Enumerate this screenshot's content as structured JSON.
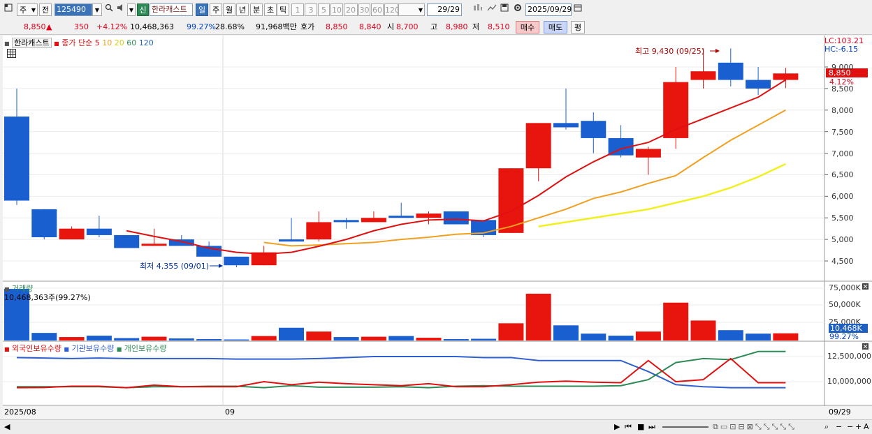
{
  "toolbar": {
    "market_select": "주",
    "market_prev": "전",
    "code": "125490",
    "new_badge": "신",
    "stock_name": "한라캐스트",
    "period_tabs": [
      "일",
      "주",
      "월",
      "년",
      "분",
      "초",
      "틱"
    ],
    "period_selected": "일",
    "intervals": [
      "1",
      "3",
      "5",
      "10",
      "20",
      "30",
      "60",
      "120"
    ],
    "count": "29/29",
    "date": "2025/09/29"
  },
  "infobar": {
    "price": "8,850",
    "change": "350",
    "change_pct": "+4.12%",
    "volume": "10,468,363",
    "vol_ratio": "99.27%",
    "turnover_ratio": "28.68%",
    "amount": "91,968백만",
    "quote_label": "호가",
    "ask": "8,850",
    "bid": "8,840",
    "open_label": "시",
    "open": "8,700",
    "high_label": "고",
    "high": "8,980",
    "low_label": "저",
    "low": "8,510",
    "buy_button": "매수",
    "sell_button": "매도",
    "eval_button": "평"
  },
  "price_panel": {
    "name_label": "한라캐스트",
    "ma_label": "종가 단순",
    "ma_periods": [
      "5",
      "10",
      "20",
      "60",
      "120"
    ],
    "ma_colors": [
      "#e01010",
      "#f0a020",
      "#f0f020",
      "#2e8b57",
      "#2060c0"
    ],
    "lc_label": "LC:103.21",
    "hc_label": "HC:-6.15",
    "high_annotation": "최고 9,430 (09/25)",
    "low_annotation": "최저 4,355 (09/01)",
    "current_price_tag": "8,850",
    "current_pct_tag": "4.12%",
    "yticks": [
      "9,000",
      "8,500",
      "8,000",
      "7,500",
      "7,000",
      "6,500",
      "6,000",
      "5,500",
      "5,000",
      "4,500"
    ]
  },
  "volume_panel": {
    "title": "거래량",
    "info": "10,468,363주(99.27%)",
    "yticks": [
      "75,000K",
      "50,000K",
      "25,000K"
    ],
    "current_tag": "10,468K",
    "current_pct": "99.27%"
  },
  "holdings_panel": {
    "legend": [
      "외국인보유수량",
      "기관보유수량",
      "개인보유수량"
    ],
    "legend_colors": [
      "#e01010",
      "#3060d0",
      "#2e8b57"
    ],
    "yticks": [
      "12,500,000",
      "10,000,000"
    ]
  },
  "xaxis": {
    "start_label": "2025/08",
    "mid_label": "09",
    "end_label": "09/29"
  },
  "chart_data": {
    "type": "candlestick",
    "candles": [
      {
        "o": 7850,
        "h": 8500,
        "l": 5800,
        "c": 5900
      },
      {
        "o": 5700,
        "h": 5700,
        "l": 5000,
        "c": 5050
      },
      {
        "o": 5000,
        "h": 5300,
        "l": 5000,
        "c": 5250
      },
      {
        "o": 5250,
        "h": 5550,
        "l": 5050,
        "c": 5100
      },
      {
        "o": 5100,
        "h": 5100,
        "l": 4800,
        "c": 4800
      },
      {
        "o": 4850,
        "h": 5250,
        "l": 4850,
        "c": 4900
      },
      {
        "o": 5000,
        "h": 5100,
        "l": 4850,
        "c": 4850
      },
      {
        "o": 4850,
        "h": 4950,
        "l": 4600,
        "c": 4600
      },
      {
        "o": 4600,
        "h": 4600,
        "l": 4355,
        "c": 4400
      },
      {
        "o": 4400,
        "h": 4850,
        "l": 4400,
        "c": 4700
      },
      {
        "o": 5000,
        "h": 5500,
        "l": 4950,
        "c": 4950
      },
      {
        "o": 5000,
        "h": 5650,
        "l": 4950,
        "c": 5400
      },
      {
        "o": 5450,
        "h": 5500,
        "l": 5250,
        "c": 5400
      },
      {
        "o": 5400,
        "h": 5650,
        "l": 5400,
        "c": 5500
      },
      {
        "o": 5550,
        "h": 5850,
        "l": 5500,
        "c": 5500
      },
      {
        "o": 5500,
        "h": 5650,
        "l": 5350,
        "c": 5600
      },
      {
        "o": 5650,
        "h": 5650,
        "l": 5350,
        "c": 5350
      },
      {
        "o": 5450,
        "h": 5450,
        "l": 5050,
        "c": 5100
      },
      {
        "o": 5150,
        "h": 6650,
        "l": 5150,
        "c": 6650
      },
      {
        "o": 6650,
        "h": 7350,
        "l": 6350,
        "c": 7700
      },
      {
        "o": 7700,
        "h": 8500,
        "l": 7550,
        "c": 7600
      },
      {
        "o": 7750,
        "h": 7950,
        "l": 7000,
        "c": 7350
      },
      {
        "o": 7350,
        "h": 7650,
        "l": 6900,
        "c": 6950
      },
      {
        "o": 6900,
        "h": 7150,
        "l": 6500,
        "c": 7100
      },
      {
        "o": 7350,
        "h": 9000,
        "l": 7100,
        "c": 8650
      },
      {
        "o": 8700,
        "h": 9430,
        "l": 8500,
        "c": 8900
      },
      {
        "o": 9100,
        "h": 9430,
        "l": 8550,
        "c": 8700
      },
      {
        "o": 8700,
        "h": 9000,
        "l": 8350,
        "c": 8500
      },
      {
        "o": 8700,
        "h": 8980,
        "l": 8510,
        "c": 8850
      }
    ],
    "volume_k": [
      75000,
      11000,
      5000,
      7000,
      3500,
      5500,
      3000,
      2000,
      1500,
      6500,
      18500,
      13000,
      5000,
      5500,
      6500,
      4000,
      2000,
      2500,
      25000,
      68000,
      22000,
      10000,
      7000,
      13000,
      55000,
      29000,
      15000,
      10000,
      10468
    ],
    "volume_up": [
      false,
      false,
      true,
      false,
      false,
      true,
      false,
      false,
      false,
      true,
      false,
      true,
      false,
      true,
      false,
      true,
      false,
      false,
      true,
      true,
      false,
      false,
      false,
      true,
      true,
      true,
      false,
      false,
      true
    ],
    "ma5": [
      null,
      null,
      null,
      null,
      5200,
      5070,
      4950,
      4800,
      4700,
      4660,
      4700,
      4840,
      5000,
      5200,
      5350,
      5450,
      5470,
      5430,
      5650,
      6020,
      6450,
      6800,
      7100,
      7250,
      7550,
      7800,
      8050,
      8300,
      8700
    ],
    "ma10": [
      null,
      null,
      null,
      null,
      null,
      null,
      null,
      null,
      null,
      4930,
      4850,
      4870,
      4900,
      4930,
      5000,
      5050,
      5120,
      5150,
      5300,
      5500,
      5700,
      5950,
      6100,
      6300,
      6480,
      6900,
      7300,
      7650,
      8000
    ],
    "ma20": [
      null,
      null,
      null,
      null,
      null,
      null,
      null,
      null,
      null,
      null,
      null,
      null,
      null,
      null,
      null,
      null,
      null,
      null,
      null,
      5300,
      5400,
      5500,
      5600,
      5700,
      5850,
      6000,
      6200,
      6450,
      6750
    ],
    "foreign": [
      9.4,
      9.42,
      9.55,
      9.55,
      9.4,
      9.65,
      9.5,
      9.5,
      9.5,
      10.0,
      9.7,
      9.95,
      9.8,
      9.7,
      9.6,
      9.8,
      9.5,
      9.5,
      9.7,
      9.95,
      10.05,
      9.95,
      9.9,
      12.1,
      10.0,
      10.2,
      12.3,
      9.9,
      9.9
    ],
    "institution": [
      12.4,
      12.35,
      12.3,
      12.35,
      12.3,
      12.3,
      12.3,
      12.3,
      12.25,
      12.25,
      12.25,
      12.3,
      12.4,
      12.5,
      12.5,
      12.5,
      12.5,
      12.4,
      12.4,
      12.1,
      12.1,
      12.1,
      12.1,
      11.0,
      9.7,
      9.5,
      9.4,
      9.4,
      9.4
    ],
    "individual": [
      9.5,
      9.5,
      9.5,
      9.5,
      9.4,
      9.5,
      9.5,
      9.55,
      9.55,
      9.4,
      9.6,
      9.45,
      9.45,
      9.45,
      9.5,
      9.4,
      9.55,
      9.6,
      9.55,
      9.55,
      9.55,
      9.55,
      9.6,
      10.2,
      11.9,
      12.3,
      12.2,
      13.0,
      13.0
    ]
  }
}
